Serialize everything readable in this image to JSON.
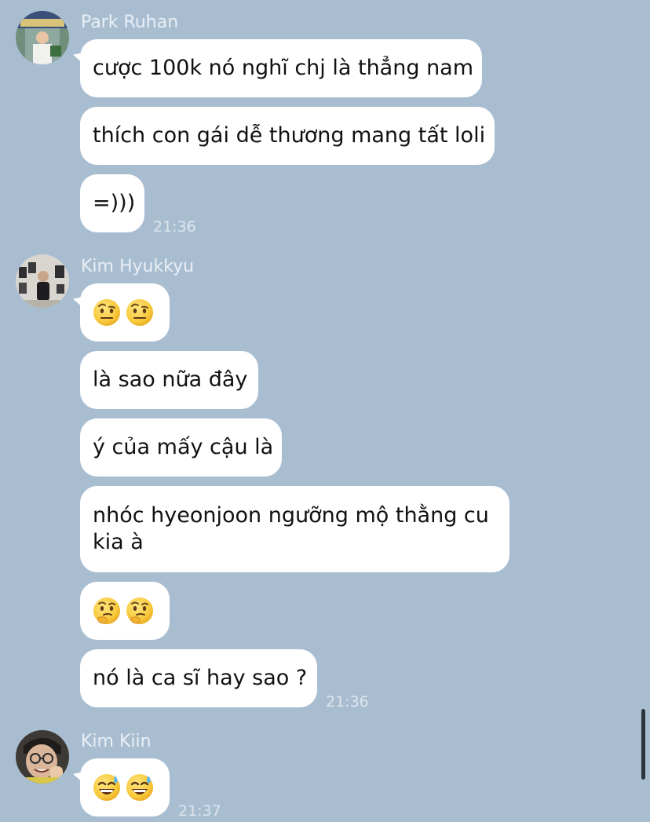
{
  "messages": {
    "group1": {
      "sender": "Park Ruhan",
      "bubbles": [
        "cược 100k nó nghĩ chj là thẳng nam",
        "thích con gái dễ thương mang tất loli",
        "=)))"
      ],
      "time": "21:36"
    },
    "group2": {
      "sender": "Kim Hyukkyu",
      "emoji_1": "raised-eyebrow-face",
      "bubbles": [
        "là sao nữa đây",
        "ý của mấy cậu là",
        "nhóc hyeonjoon ngưỡng mộ thằng cu kia à"
      ],
      "emoji_2": "thinking-face",
      "last_bubble": "nó là ca sĩ hay sao ?",
      "time": "21:36"
    },
    "group3": {
      "sender": "Kim Kiin",
      "emoji": "grinning-sweat-face",
      "time": "21:37"
    }
  },
  "colors": {
    "background": "#a9bdd1",
    "bubble": "#ffffff",
    "sender_name": "#e9eff5",
    "timestamp": "#dde6ef",
    "scrollbar": "#2d3540"
  }
}
